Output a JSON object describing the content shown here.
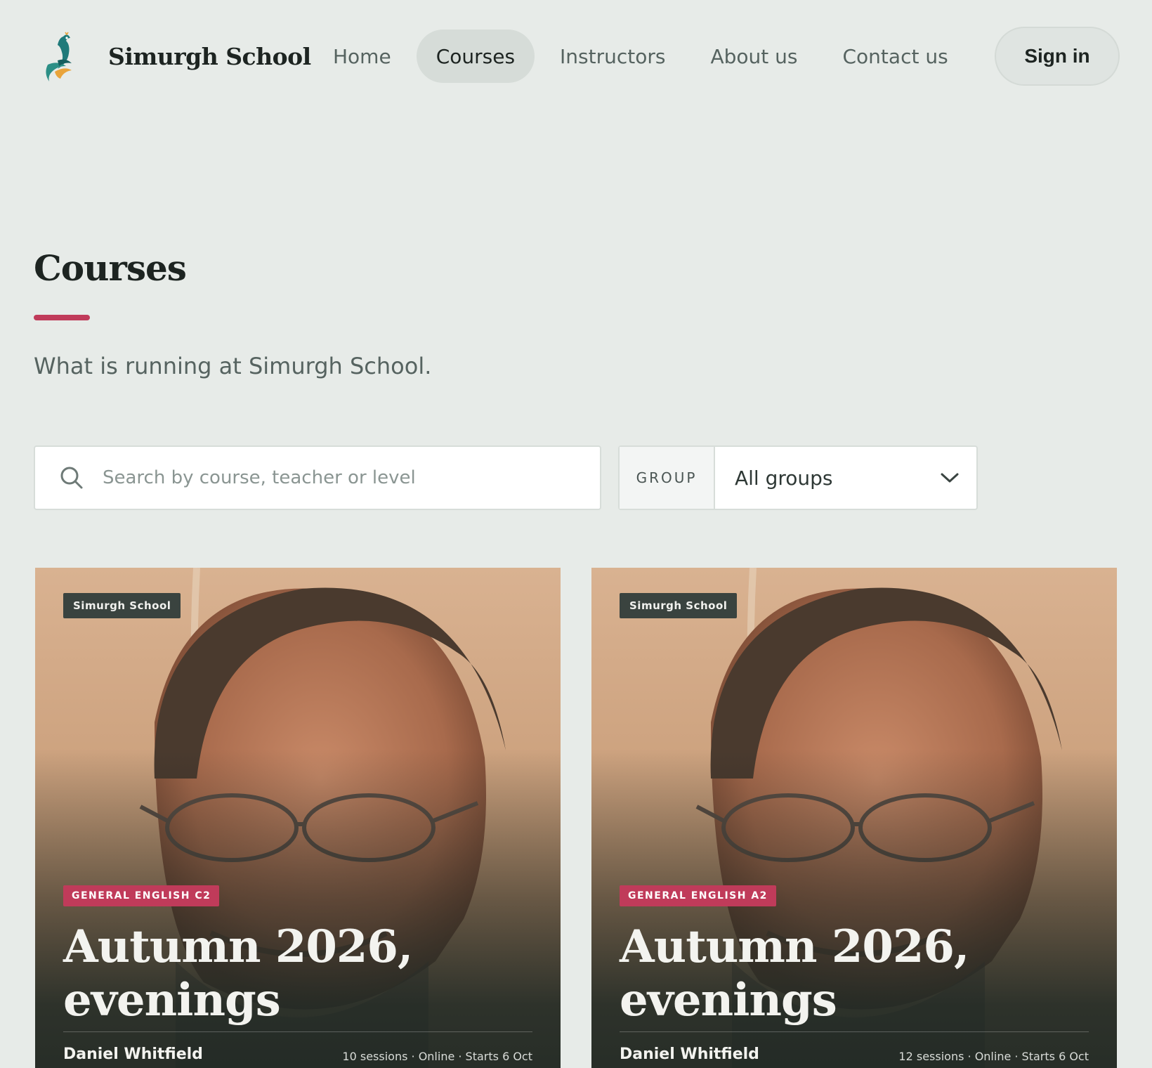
{
  "brand": {
    "name": "Simurgh School"
  },
  "nav": {
    "items": [
      {
        "label": "Home"
      },
      {
        "label": "Courses"
      },
      {
        "label": "Instructors"
      },
      {
        "label": "About us"
      },
      {
        "label": "Contact us"
      }
    ],
    "active": "Courses",
    "signin_label": "Sign in"
  },
  "page": {
    "title": "Courses",
    "subtitle": "What is running at Simurgh School.",
    "accent_color": "#c03b5a"
  },
  "search": {
    "placeholder": "Search by course, teacher or level",
    "value": ""
  },
  "filter": {
    "label": "GROUP",
    "selected": "All groups"
  },
  "cards": [
    {
      "badge": "Simurgh School",
      "tag": "GENERAL ENGLISH C2",
      "title": "Autumn 2026, evenings",
      "teacher": "Daniel Whitfield",
      "meta": "10 sessions · Online · Starts 6 Oct"
    },
    {
      "badge": "Simurgh School",
      "tag": "GENERAL ENGLISH A2",
      "title": "Autumn 2026, evenings",
      "teacher": "Daniel Whitfield",
      "meta": "12 sessions · Online · Starts 6 Oct"
    }
  ]
}
